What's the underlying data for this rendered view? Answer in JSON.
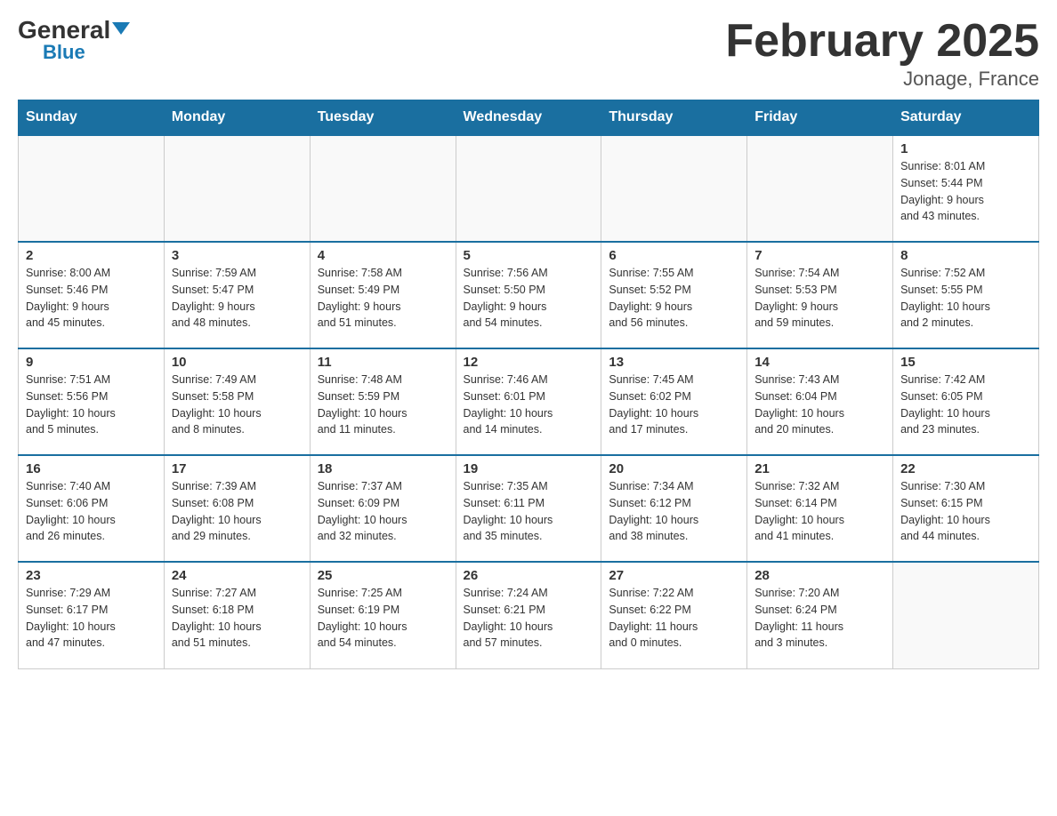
{
  "header": {
    "logo_general": "General",
    "logo_blue": "Blue",
    "month_title": "February 2025",
    "location": "Jonage, France"
  },
  "weekdays": [
    "Sunday",
    "Monday",
    "Tuesday",
    "Wednesday",
    "Thursday",
    "Friday",
    "Saturday"
  ],
  "weeks": [
    [
      {
        "day": "",
        "info": []
      },
      {
        "day": "",
        "info": []
      },
      {
        "day": "",
        "info": []
      },
      {
        "day": "",
        "info": []
      },
      {
        "day": "",
        "info": []
      },
      {
        "day": "",
        "info": []
      },
      {
        "day": "1",
        "info": [
          "Sunrise: 8:01 AM",
          "Sunset: 5:44 PM",
          "Daylight: 9 hours",
          "and 43 minutes."
        ]
      }
    ],
    [
      {
        "day": "2",
        "info": [
          "Sunrise: 8:00 AM",
          "Sunset: 5:46 PM",
          "Daylight: 9 hours",
          "and 45 minutes."
        ]
      },
      {
        "day": "3",
        "info": [
          "Sunrise: 7:59 AM",
          "Sunset: 5:47 PM",
          "Daylight: 9 hours",
          "and 48 minutes."
        ]
      },
      {
        "day": "4",
        "info": [
          "Sunrise: 7:58 AM",
          "Sunset: 5:49 PM",
          "Daylight: 9 hours",
          "and 51 minutes."
        ]
      },
      {
        "day": "5",
        "info": [
          "Sunrise: 7:56 AM",
          "Sunset: 5:50 PM",
          "Daylight: 9 hours",
          "and 54 minutes."
        ]
      },
      {
        "day": "6",
        "info": [
          "Sunrise: 7:55 AM",
          "Sunset: 5:52 PM",
          "Daylight: 9 hours",
          "and 56 minutes."
        ]
      },
      {
        "day": "7",
        "info": [
          "Sunrise: 7:54 AM",
          "Sunset: 5:53 PM",
          "Daylight: 9 hours",
          "and 59 minutes."
        ]
      },
      {
        "day": "8",
        "info": [
          "Sunrise: 7:52 AM",
          "Sunset: 5:55 PM",
          "Daylight: 10 hours",
          "and 2 minutes."
        ]
      }
    ],
    [
      {
        "day": "9",
        "info": [
          "Sunrise: 7:51 AM",
          "Sunset: 5:56 PM",
          "Daylight: 10 hours",
          "and 5 minutes."
        ]
      },
      {
        "day": "10",
        "info": [
          "Sunrise: 7:49 AM",
          "Sunset: 5:58 PM",
          "Daylight: 10 hours",
          "and 8 minutes."
        ]
      },
      {
        "day": "11",
        "info": [
          "Sunrise: 7:48 AM",
          "Sunset: 5:59 PM",
          "Daylight: 10 hours",
          "and 11 minutes."
        ]
      },
      {
        "day": "12",
        "info": [
          "Sunrise: 7:46 AM",
          "Sunset: 6:01 PM",
          "Daylight: 10 hours",
          "and 14 minutes."
        ]
      },
      {
        "day": "13",
        "info": [
          "Sunrise: 7:45 AM",
          "Sunset: 6:02 PM",
          "Daylight: 10 hours",
          "and 17 minutes."
        ]
      },
      {
        "day": "14",
        "info": [
          "Sunrise: 7:43 AM",
          "Sunset: 6:04 PM",
          "Daylight: 10 hours",
          "and 20 minutes."
        ]
      },
      {
        "day": "15",
        "info": [
          "Sunrise: 7:42 AM",
          "Sunset: 6:05 PM",
          "Daylight: 10 hours",
          "and 23 minutes."
        ]
      }
    ],
    [
      {
        "day": "16",
        "info": [
          "Sunrise: 7:40 AM",
          "Sunset: 6:06 PM",
          "Daylight: 10 hours",
          "and 26 minutes."
        ]
      },
      {
        "day": "17",
        "info": [
          "Sunrise: 7:39 AM",
          "Sunset: 6:08 PM",
          "Daylight: 10 hours",
          "and 29 minutes."
        ]
      },
      {
        "day": "18",
        "info": [
          "Sunrise: 7:37 AM",
          "Sunset: 6:09 PM",
          "Daylight: 10 hours",
          "and 32 minutes."
        ]
      },
      {
        "day": "19",
        "info": [
          "Sunrise: 7:35 AM",
          "Sunset: 6:11 PM",
          "Daylight: 10 hours",
          "and 35 minutes."
        ]
      },
      {
        "day": "20",
        "info": [
          "Sunrise: 7:34 AM",
          "Sunset: 6:12 PM",
          "Daylight: 10 hours",
          "and 38 minutes."
        ]
      },
      {
        "day": "21",
        "info": [
          "Sunrise: 7:32 AM",
          "Sunset: 6:14 PM",
          "Daylight: 10 hours",
          "and 41 minutes."
        ]
      },
      {
        "day": "22",
        "info": [
          "Sunrise: 7:30 AM",
          "Sunset: 6:15 PM",
          "Daylight: 10 hours",
          "and 44 minutes."
        ]
      }
    ],
    [
      {
        "day": "23",
        "info": [
          "Sunrise: 7:29 AM",
          "Sunset: 6:17 PM",
          "Daylight: 10 hours",
          "and 47 minutes."
        ]
      },
      {
        "day": "24",
        "info": [
          "Sunrise: 7:27 AM",
          "Sunset: 6:18 PM",
          "Daylight: 10 hours",
          "and 51 minutes."
        ]
      },
      {
        "day": "25",
        "info": [
          "Sunrise: 7:25 AM",
          "Sunset: 6:19 PM",
          "Daylight: 10 hours",
          "and 54 minutes."
        ]
      },
      {
        "day": "26",
        "info": [
          "Sunrise: 7:24 AM",
          "Sunset: 6:21 PM",
          "Daylight: 10 hours",
          "and 57 minutes."
        ]
      },
      {
        "day": "27",
        "info": [
          "Sunrise: 7:22 AM",
          "Sunset: 6:22 PM",
          "Daylight: 11 hours",
          "and 0 minutes."
        ]
      },
      {
        "day": "28",
        "info": [
          "Sunrise: 7:20 AM",
          "Sunset: 6:24 PM",
          "Daylight: 11 hours",
          "and 3 minutes."
        ]
      },
      {
        "day": "",
        "info": []
      }
    ]
  ]
}
